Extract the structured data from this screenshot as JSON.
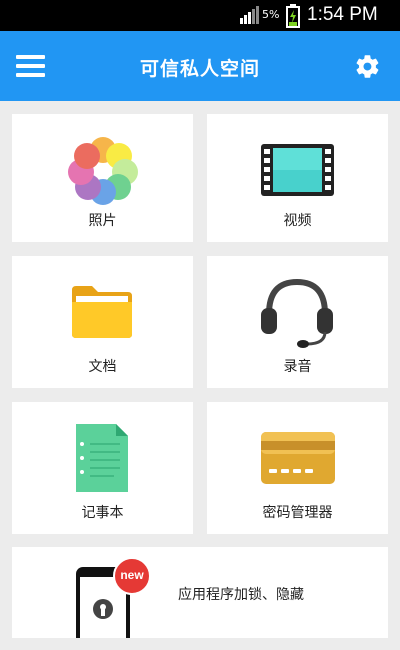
{
  "status_bar": {
    "battery_percent": "5%",
    "time": "1:54 PM"
  },
  "app_bar": {
    "title": "可信私人空间",
    "menu_icon": "hamburger-menu-icon",
    "settings_icon": "gear-icon"
  },
  "grid": {
    "items": [
      {
        "label": "照片",
        "icon": "photos-flower-icon"
      },
      {
        "label": "视频",
        "icon": "film-strip-icon"
      },
      {
        "label": "文档",
        "icon": "folder-icon"
      },
      {
        "label": "录音",
        "icon": "headset-icon"
      },
      {
        "label": "记事本",
        "icon": "notepad-icon"
      },
      {
        "label": "密码管理器",
        "icon": "credit-card-icon"
      }
    ]
  },
  "app_lock": {
    "label": "应用程序加锁、隐藏",
    "badge": "new",
    "icon": "phone-lock-icon"
  },
  "colors": {
    "app_bar": "#2196f3",
    "badge": "#e53935",
    "background": "#ececec"
  }
}
